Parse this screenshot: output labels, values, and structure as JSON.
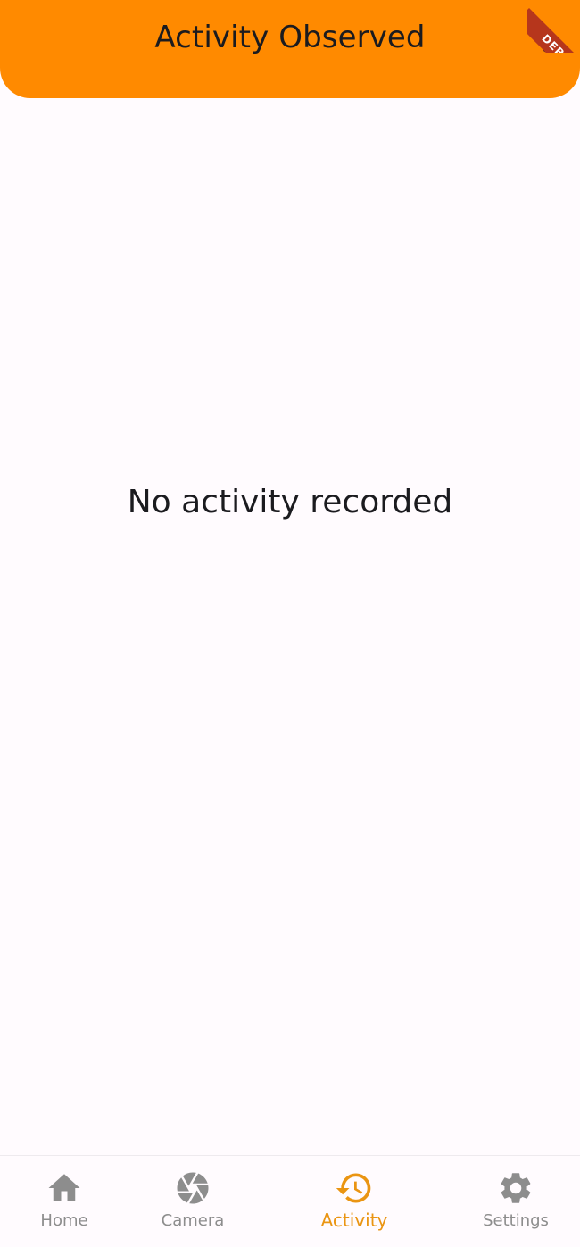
{
  "app_bar": {
    "title": "Activity Observed",
    "background": "#ff8a00",
    "menu_icon": "more-vert-icon"
  },
  "debug_banner": {
    "label": "DEBUG",
    "color": "#b6361c"
  },
  "main": {
    "empty_message": "No activity recorded"
  },
  "bottom_nav": {
    "active_index": 2,
    "active_color": "#ea9512",
    "inactive_color": "#8d8d8d",
    "items": [
      {
        "label": "Home",
        "icon": "home-icon"
      },
      {
        "label": "Camera",
        "icon": "camera-shutter-icon"
      },
      {
        "label": "Activity",
        "icon": "history-icon"
      },
      {
        "label": "Settings",
        "icon": "gear-icon"
      }
    ]
  }
}
